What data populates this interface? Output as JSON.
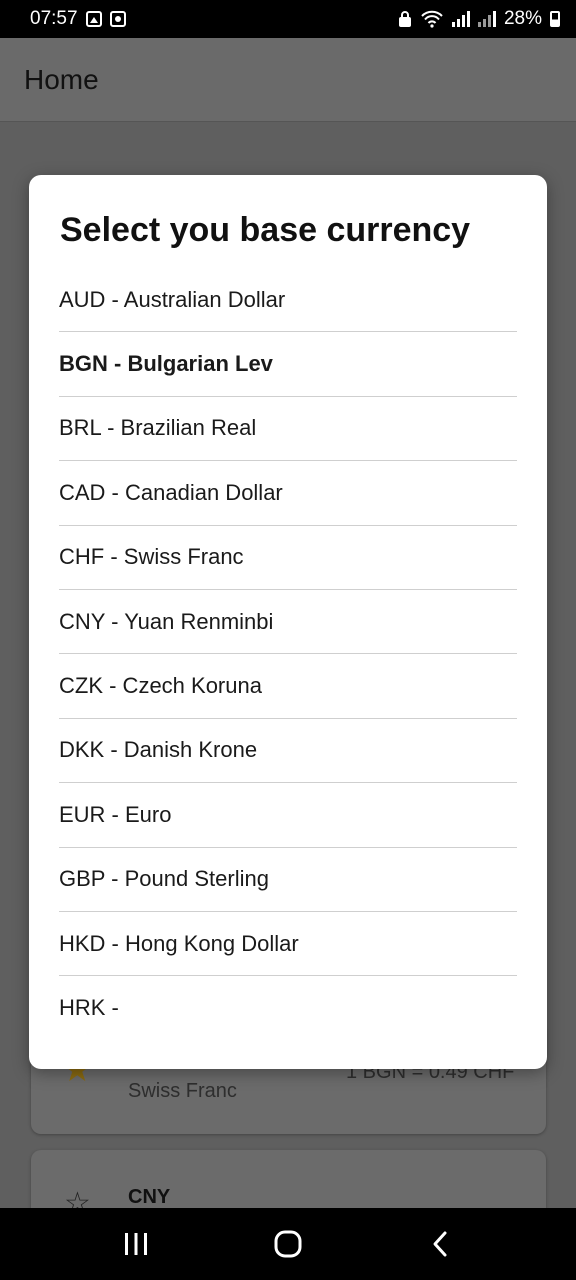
{
  "status_bar": {
    "time": "07:57",
    "battery_percent": "28%",
    "icons": [
      "photo-icon",
      "camera-icon",
      "lock-icon",
      "wifi-icon",
      "signal-icon",
      "signal-icon",
      "battery-icon"
    ]
  },
  "app_bar": {
    "title": "Home"
  },
  "background": {
    "card1_subtitle": "Swiss Franc",
    "card1_rate": "1 BGN = 0.49 CHF",
    "card2_code": "CNY"
  },
  "dialog": {
    "title": "Select you base currency",
    "selected_code": "BGN",
    "items": [
      {
        "label": "AUD - Australian Dollar"
      },
      {
        "label": "BGN - Bulgarian Lev"
      },
      {
        "label": "BRL - Brazilian Real"
      },
      {
        "label": "CAD - Canadian Dollar"
      },
      {
        "label": "CHF - Swiss Franc"
      },
      {
        "label": "CNY - Yuan Renminbi"
      },
      {
        "label": "CZK - Czech Koruna"
      },
      {
        "label": "DKK - Danish Krone"
      },
      {
        "label": "EUR - Euro"
      },
      {
        "label": "GBP - Pound Sterling"
      },
      {
        "label": "HKD - Hong Kong Dollar"
      },
      {
        "label": "HRK -"
      }
    ]
  },
  "nav_bar": {
    "buttons": [
      "recent-apps-icon",
      "home-icon",
      "back-icon"
    ]
  }
}
